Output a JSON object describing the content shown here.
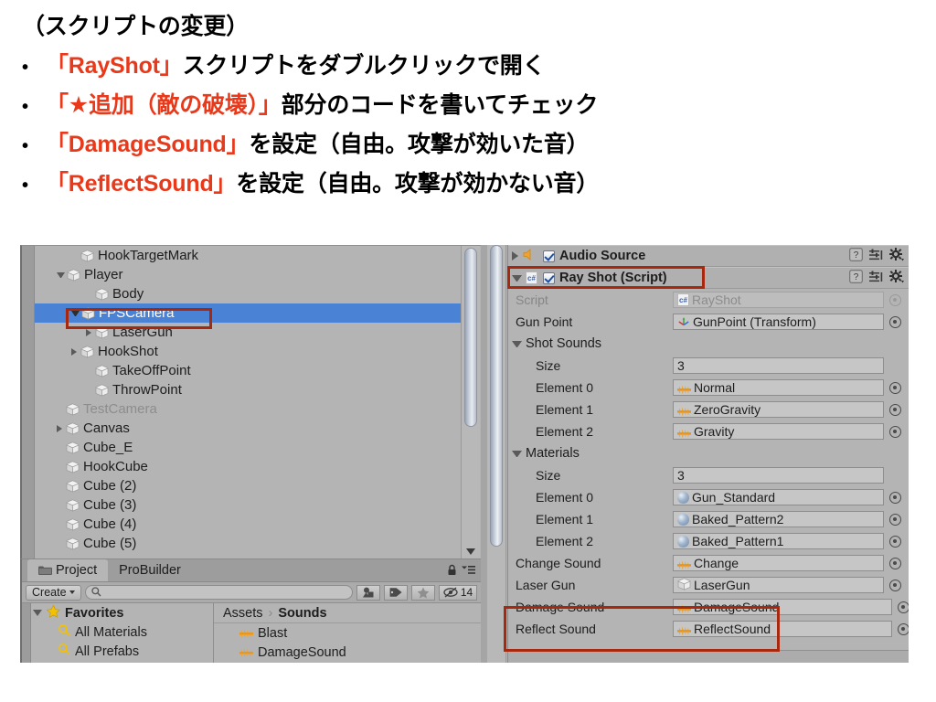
{
  "slide": {
    "heading": "（スクリプトの変更）",
    "bullets": [
      {
        "parts": [
          {
            "t": "「RayShot」",
            "hl": true
          },
          {
            "t": "スクリプトをダブルクリックで開く",
            "hl": false
          }
        ]
      },
      {
        "parts": [
          {
            "t": "「★追加（敵の破壊）」",
            "hl": true
          },
          {
            "t": "部分のコードを書いてチェック",
            "hl": false
          }
        ]
      },
      {
        "parts": [
          {
            "t": "「DamageSound」",
            "hl": true
          },
          {
            "t": "を設定（自由。攻撃が効いた音）",
            "hl": false
          }
        ]
      },
      {
        "parts": [
          {
            "t": "「ReflectSound」",
            "hl": true
          },
          {
            "t": "を設定（自由。攻撃が効かない音）",
            "hl": false
          }
        ]
      }
    ],
    "bullet_mark": "•",
    "highlight_color": "#e8391b",
    "text_color": "#000000"
  },
  "hierarchy": {
    "rows": [
      {
        "label": "HookTargetMark",
        "indent": 2,
        "arrow": "none",
        "dim": false,
        "selected": false
      },
      {
        "label": "Player",
        "indent": 1,
        "arrow": "expanded",
        "dim": false,
        "selected": false
      },
      {
        "label": "Body",
        "indent": 3,
        "arrow": "none",
        "dim": false,
        "selected": false
      },
      {
        "label": "FPSCamera",
        "indent": 2,
        "arrow": "expanded",
        "dim": false,
        "selected": true
      },
      {
        "label": "LaserGun",
        "indent": 3,
        "arrow": "collapsed",
        "dim": false,
        "selected": false
      },
      {
        "label": "HookShot",
        "indent": 2,
        "arrow": "collapsed",
        "dim": false,
        "selected": false
      },
      {
        "label": "TakeOffPoint",
        "indent": 3,
        "arrow": "none",
        "dim": false,
        "selected": false
      },
      {
        "label": "ThrowPoint",
        "indent": 3,
        "arrow": "none",
        "dim": false,
        "selected": false
      },
      {
        "label": "TestCamera",
        "indent": 1,
        "arrow": "none",
        "dim": true,
        "selected": false
      },
      {
        "label": "Canvas",
        "indent": 1,
        "arrow": "collapsed",
        "dim": false,
        "selected": false
      },
      {
        "label": "Cube_E",
        "indent": 1,
        "arrow": "none",
        "dim": false,
        "selected": false
      },
      {
        "label": "HookCube",
        "indent": 1,
        "arrow": "none",
        "dim": false,
        "selected": false
      },
      {
        "label": "Cube (2)",
        "indent": 1,
        "arrow": "none",
        "dim": false,
        "selected": false
      },
      {
        "label": "Cube (3)",
        "indent": 1,
        "arrow": "none",
        "dim": false,
        "selected": false
      },
      {
        "label": "Cube (4)",
        "indent": 1,
        "arrow": "none",
        "dim": false,
        "selected": false
      },
      {
        "label": "Cube (5)",
        "indent": 1,
        "arrow": "none",
        "dim": false,
        "selected": false
      }
    ],
    "selection_color": "#4a82d6",
    "highlight_box_color": "#a6290f"
  },
  "project": {
    "tabs": [
      {
        "label": "Project",
        "active": true
      },
      {
        "label": "ProBuilder",
        "active": false
      }
    ],
    "toolbar": {
      "create_label": "Create",
      "search_value": "",
      "hidden_count": "14"
    },
    "favorites": {
      "label": "Favorites",
      "items": [
        "All Materials",
        "All Prefabs"
      ]
    },
    "breadcrumb": [
      "Assets",
      "Sounds"
    ],
    "breadcrumb_sep": "›",
    "assets": [
      {
        "label": "Blast",
        "icon": "audio-icon"
      },
      {
        "label": "DamageSound",
        "icon": "audio-icon"
      }
    ]
  },
  "inspector": {
    "components": [
      {
        "title": "Audio Source",
        "expanded": false,
        "enabled": true,
        "icon": "audio-source-icon",
        "highlighted": false
      },
      {
        "title": "Ray Shot (Script)",
        "expanded": true,
        "enabled": true,
        "icon": "csharp-icon",
        "highlighted": true
      }
    ],
    "fields": [
      {
        "kind": "field",
        "label": "Script",
        "value": "RayShot",
        "icon": "csharp-icon",
        "readonly": true,
        "picker": "faded",
        "indent": 1,
        "highlight": false
      },
      {
        "kind": "field",
        "label": "Gun Point",
        "value": "GunPoint (Transform)",
        "icon": "transform-icon",
        "readonly": false,
        "picker": "solid",
        "indent": 1,
        "highlight": false
      },
      {
        "kind": "fold",
        "label": "Shot Sounds"
      },
      {
        "kind": "field",
        "label": "Size",
        "value": "3",
        "icon": "none",
        "readonly": false,
        "picker": "none",
        "indent": 2,
        "highlight": false
      },
      {
        "kind": "field",
        "label": "Element 0",
        "value": "Normal",
        "icon": "audio-icon",
        "readonly": false,
        "picker": "solid",
        "indent": 2,
        "highlight": false
      },
      {
        "kind": "field",
        "label": "Element 1",
        "value": "ZeroGravity",
        "icon": "audio-icon",
        "readonly": false,
        "picker": "solid",
        "indent": 2,
        "highlight": false
      },
      {
        "kind": "field",
        "label": "Element 2",
        "value": "Gravity",
        "icon": "audio-icon",
        "readonly": false,
        "picker": "solid",
        "indent": 2,
        "highlight": false
      },
      {
        "kind": "fold",
        "label": "Materials"
      },
      {
        "kind": "field",
        "label": "Size",
        "value": "3",
        "icon": "none",
        "readonly": false,
        "picker": "none",
        "indent": 2,
        "highlight": false
      },
      {
        "kind": "field",
        "label": "Element 0",
        "value": "Gun_Standard",
        "icon": "material-icon",
        "readonly": false,
        "picker": "solid",
        "indent": 2,
        "highlight": false
      },
      {
        "kind": "field",
        "label": "Element 1",
        "value": "Baked_Pattern2",
        "icon": "material-icon",
        "readonly": false,
        "picker": "solid",
        "indent": 2,
        "highlight": false
      },
      {
        "kind": "field",
        "label": "Element 2",
        "value": "Baked_Pattern1",
        "icon": "material-icon",
        "readonly": false,
        "picker": "solid",
        "indent": 2,
        "highlight": false
      },
      {
        "kind": "field",
        "label": "Change Sound",
        "value": "Change",
        "icon": "audio-icon",
        "readonly": false,
        "picker": "solid",
        "indent": 1,
        "highlight": false
      },
      {
        "kind": "field",
        "label": "Laser Gun",
        "value": "LaserGun",
        "icon": "cube-icon",
        "readonly": false,
        "picker": "solid",
        "indent": 1,
        "highlight": false
      },
      {
        "kind": "field",
        "label": "Damage Sound",
        "value": "DamageSound",
        "icon": "audio-icon",
        "readonly": false,
        "picker": "solid",
        "indent": 1,
        "highlight": true
      },
      {
        "kind": "field",
        "label": "Reflect Sound",
        "value": "ReflectSound",
        "icon": "audio-icon",
        "readonly": false,
        "picker": "solid",
        "indent": 1,
        "highlight": true
      }
    ]
  }
}
